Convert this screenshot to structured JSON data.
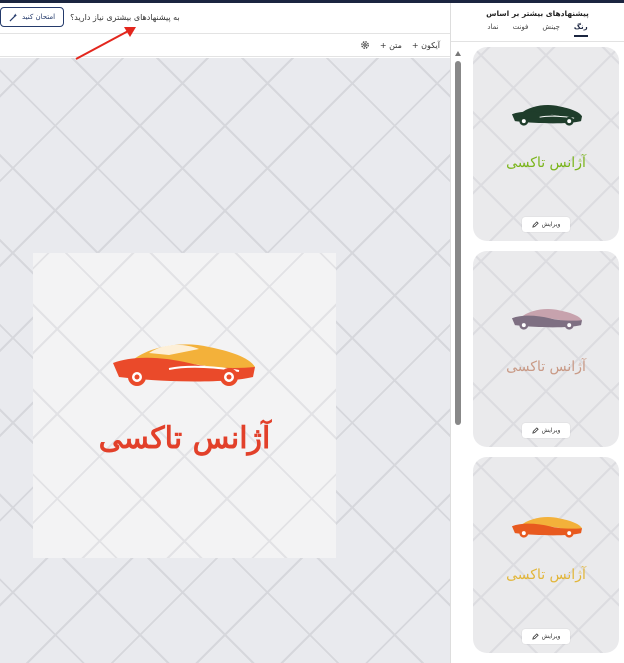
{
  "topbar": {
    "suggest_question": "به پیشنهادهای بیشتری نیاز دارید؟",
    "try_button": "امتحان کنید"
  },
  "toolbar": {
    "text_label": "+ متن",
    "icon_label": "+ آیکون"
  },
  "artboard": {
    "logo_text": "آژانس تاکسی",
    "text_color": "#e2402a"
  },
  "panel": {
    "title": "پیشنهادهای بیشتر بر اساس",
    "tabs": [
      {
        "label": "رنگ",
        "active": true
      },
      {
        "label": "چینش",
        "active": false
      },
      {
        "label": "فونت",
        "active": false
      },
      {
        "label": "نماد",
        "active": false
      }
    ],
    "cards": [
      {
        "logo_text": "آژانس تاکسی",
        "text_color": "#7bb51c",
        "car_color": "#1f3d2b",
        "edit_label": "ویرایش"
      },
      {
        "logo_text": "آژانس تاکسی",
        "text_color": "#c99a86",
        "car_color": "#7e6f82",
        "edit_label": "ویرایش"
      },
      {
        "logo_text": "آژانس تاکسی",
        "text_color": "#e2b63a",
        "car_color": "#e85a1f",
        "edit_label": "ویرایش"
      }
    ]
  }
}
